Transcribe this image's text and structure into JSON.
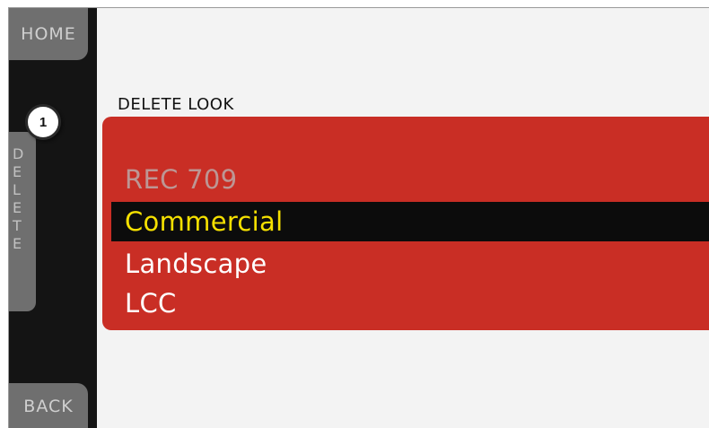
{
  "sidebar": {
    "home_label": "HOME",
    "back_label": "BACK",
    "delete_letters": [
      "D",
      "E",
      "L",
      "E",
      "T",
      "E"
    ]
  },
  "callout": {
    "number": "1"
  },
  "main": {
    "title": "DELETE LOOK"
  },
  "looks": {
    "items": [
      {
        "label": "REC 709",
        "state": "disabled"
      },
      {
        "label": "Commercial",
        "state": "selected"
      },
      {
        "label": "Landscape",
        "state": "normal"
      },
      {
        "label": "LCC",
        "state": "normal"
      }
    ]
  },
  "colors": {
    "panel": "#c92e25",
    "selected_bg": "#0c0c0c",
    "selected_text": "#f5e000",
    "sidebar_bg": "#141414",
    "button_bg": "#6f6f6f"
  }
}
